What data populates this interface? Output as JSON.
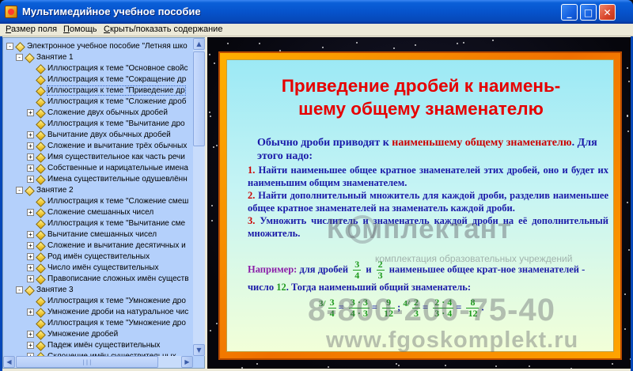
{
  "window": {
    "title": "Мультимедийное учебное пособие",
    "buttons": {
      "minimize": "_",
      "maximize": "□",
      "close": "✕"
    }
  },
  "menu": {
    "items": [
      "Размер поля",
      "Помощь",
      "Скрыть/показать содержание"
    ]
  },
  "sidebar": {
    "tree": [
      {
        "text": "Электронное учебное пособие \"Летняя шко",
        "level": 0,
        "expander": "-",
        "open": true
      },
      {
        "text": "Занятие 1",
        "level": 1,
        "expander": "-",
        "open": true
      },
      {
        "text": "Иллюстрация к теме \"Основное свойс",
        "level": 2,
        "expander": ""
      },
      {
        "text": "Иллюстрация к теме \"Сокращение др",
        "level": 2,
        "expander": ""
      },
      {
        "text": "Иллюстрация к теме \"Приведение др",
        "level": 2,
        "expander": "",
        "selected": true
      },
      {
        "text": "Иллюстрация к теме \"Сложение дроб",
        "level": 2,
        "expander": ""
      },
      {
        "text": "Сложение двух обычных дробей",
        "level": 2,
        "expander": "+"
      },
      {
        "text": "Иллюстрация к теме \"Вычитание дро",
        "level": 2,
        "expander": ""
      },
      {
        "text": "Вычитание двух обычных дробей",
        "level": 2,
        "expander": "+"
      },
      {
        "text": "Сложение и вычитание трёх обычных",
        "level": 2,
        "expander": "+"
      },
      {
        "text": "Имя существительное как часть речи",
        "level": 2,
        "expander": "+"
      },
      {
        "text": "Собственные и нарицательные имена",
        "level": 2,
        "expander": "+"
      },
      {
        "text": "Имена существительные одушевлённ",
        "level": 2,
        "expander": "+"
      },
      {
        "text": "Занятие 2",
        "level": 1,
        "expander": "-",
        "open": true
      },
      {
        "text": "Иллюстрация к теме \"Сложение смеш",
        "level": 2,
        "expander": ""
      },
      {
        "text": "Сложение смешанных чисел",
        "level": 2,
        "expander": "+"
      },
      {
        "text": "Иллюстрация к теме \"Вычитание сме",
        "level": 2,
        "expander": ""
      },
      {
        "text": "Вычитание смешанных чисел",
        "level": 2,
        "expander": "+"
      },
      {
        "text": "Сложение и вычитание десятичных и",
        "level": 2,
        "expander": "+"
      },
      {
        "text": "Род имён существительных",
        "level": 2,
        "expander": "+"
      },
      {
        "text": "Число имён существительных",
        "level": 2,
        "expander": "+"
      },
      {
        "text": "Правописание сложных имён существ",
        "level": 2,
        "expander": "+"
      },
      {
        "text": "Занятие 3",
        "level": 1,
        "expander": "-",
        "open": true
      },
      {
        "text": "Иллюстрация к теме \"Умножение дро",
        "level": 2,
        "expander": ""
      },
      {
        "text": "Умножение дроби на натуральное чис",
        "level": 2,
        "expander": "+"
      },
      {
        "text": "Иллюстрация к теме \"Умножение дро",
        "level": 2,
        "expander": ""
      },
      {
        "text": "Умножение дробей",
        "level": 2,
        "expander": "+"
      },
      {
        "text": "Падеж имён существительных",
        "level": 2,
        "expander": "+"
      },
      {
        "text": "Склонение имён существительных",
        "level": 2,
        "expander": "+"
      }
    ],
    "hscroll_grip": "|||"
  },
  "slide": {
    "title_line1": "Приведение дробей к наимень-",
    "title_line2": "шему общему знаменателю",
    "intro_pre": "Обычно дроби приводят к ",
    "intro_red": "наименьшему общему знаменателю",
    "intro_post": ". Для этого надо:",
    "steps": [
      {
        "num": "1.",
        "text": " Найти наименьшее общее кратное знаменателей этих дробей, оно и будет их наименьшим общим знаменателем."
      },
      {
        "num": "2.",
        "text": " Найти дополнительный множитель для каждой дроби, разделив наименьшее общее кратное знаменателей на знаменатель каждой дроби."
      },
      {
        "num": "3.",
        "text": " Умножить числитель и знаменатель каждой дроби на её дополнительный множитель."
      }
    ],
    "example_label": "Например:",
    "example_pre": " для дробей",
    "example_and": "и",
    "example_mid": "наименьшее общее крат-ное знаменателей - число",
    "example_lcm": "12",
    "example_post": ". Тогда наименьший общий знаменатель:",
    "fractions": {
      "f1": {
        "n": "3",
        "d": "4"
      },
      "f2": {
        "n": "2",
        "d": "3"
      },
      "mult1": "3/",
      "mult2": "4/",
      "e1a": {
        "n": "3",
        "d": "4"
      },
      "e1b": {
        "n": "3 · 3",
        "d": "4 · 3"
      },
      "e1c": {
        "n": "9",
        "d": "12"
      },
      "e2a": {
        "n": "2",
        "d": "3"
      },
      "e2b": {
        "n": "2 · 4",
        "d": "3 · 4"
      },
      "e2c": {
        "n": "8",
        "d": "12"
      }
    }
  },
  "watermark": {
    "brand": "Комплектант",
    "sub": "комплектация образовательных учреждений",
    "phone": "8-800-200-75-40",
    "url": "www.fgoskomplekt.ru"
  }
}
